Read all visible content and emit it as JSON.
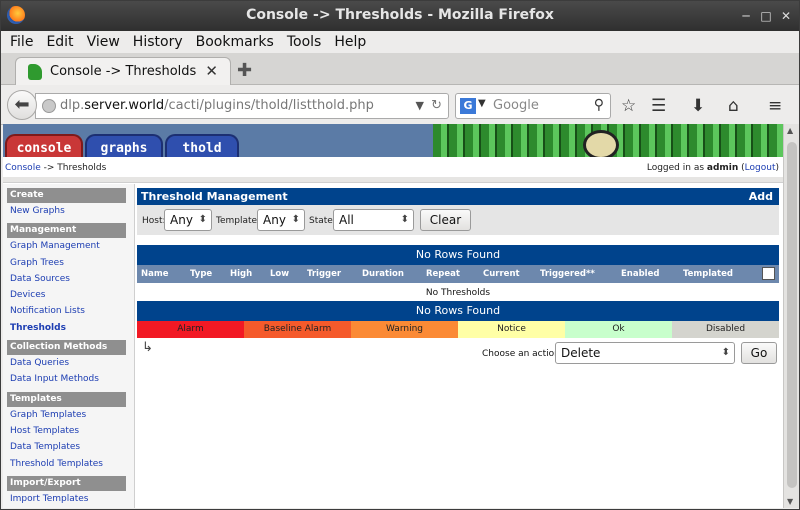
{
  "window": {
    "title": "Console -> Thresholds - Mozilla Firefox"
  },
  "menu": [
    "File",
    "Edit",
    "View",
    "History",
    "Bookmarks",
    "Tools",
    "Help"
  ],
  "browser_tab": {
    "label": "Console -> Thresholds"
  },
  "url": {
    "prefix": "dlp.",
    "host": "server.world",
    "path": "/cacti/plugins/thold/listthold.php"
  },
  "search": {
    "placeholder": "Google",
    "engine": "G"
  },
  "app_tabs": [
    "console",
    "graphs",
    "thold"
  ],
  "breadcrumb": {
    "link": "Console",
    "separator": " -> ",
    "current": "Thresholds",
    "logged_prefix": "Logged in as ",
    "user": "admin",
    "logout": "Logout"
  },
  "sidebar": {
    "create_header": "Create",
    "new_graphs": "New Graphs",
    "management_header": "Management",
    "graph_management": "Graph Management",
    "graph_trees": "Graph Trees",
    "data_sources": "Data Sources",
    "devices": "Devices",
    "notification_lists": "Notification Lists",
    "thresholds": "Thresholds",
    "collection_header": "Collection Methods",
    "data_queries": "Data Queries",
    "data_input_methods": "Data Input Methods",
    "templates_header": "Templates",
    "graph_templates": "Graph Templates",
    "host_templates": "Host Templates",
    "data_templates": "Data Templates",
    "threshold_templates": "Threshold Templates",
    "importexport_header": "Import/Export",
    "import_templates": "Import Templates"
  },
  "management": {
    "title": "Threshold Management",
    "add": "Add"
  },
  "filter": {
    "host_label": "Host:",
    "host_value": "Any",
    "template_label": "Template:",
    "template_value": "Any",
    "state_label": "State:",
    "state_value": "All",
    "clear": "Clear"
  },
  "table": {
    "no_rows": "No Rows Found",
    "columns": [
      "Name",
      "Type",
      "High",
      "Low",
      "Trigger",
      "Duration",
      "Repeat",
      "Current",
      "Triggered**",
      "Enabled",
      "Templated"
    ],
    "empty_message": "No Thresholds"
  },
  "legend": [
    {
      "label": "Alarm",
      "color": "#f21924"
    },
    {
      "label": "Baseline Alarm",
      "color": "#f55a2b"
    },
    {
      "label": "Warning",
      "color": "#fb8a35"
    },
    {
      "label": "Notice",
      "color": "#ffffa6"
    },
    {
      "label": "Ok",
      "color": "#c8ffcc"
    },
    {
      "label": "Disabled",
      "color": "#d4d4ce"
    }
  ],
  "actions": {
    "label": "Choose an action:",
    "selected": "Delete",
    "go": "Go"
  }
}
